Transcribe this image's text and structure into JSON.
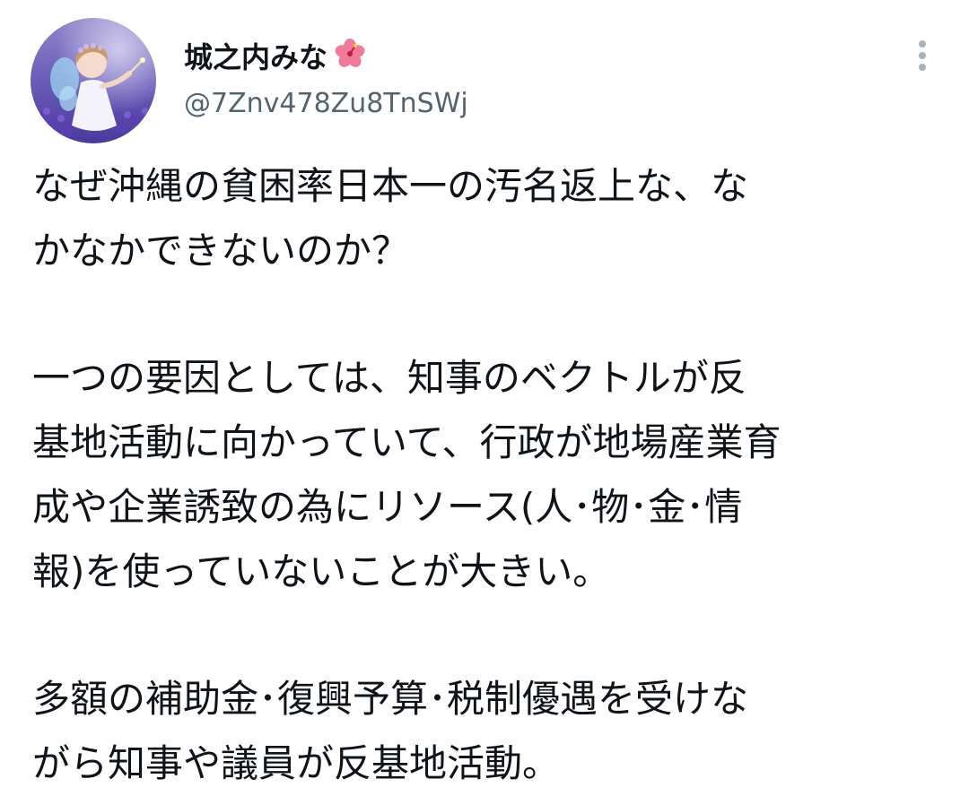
{
  "author": {
    "display_name": "城之内みな",
    "name_emoji": "hibiscus-icon",
    "handle": "@7Znv478Zu8TnSWj",
    "avatar": "child-fairy-in-lavender-field"
  },
  "menu": {
    "icon": "more-vertical-icon"
  },
  "tweet": {
    "paragraphs": [
      [
        "なぜ沖縄の貧困率日本一の汚名返上な、な",
        "かなかできないのか？"
      ],
      [
        "一つの要因としては、知事のベクトルが反",
        "基地活動に向かっていて、行政が地場産業育",
        "成や企業誘致の為にリソース(人･物･金･情",
        "報)を使っていないことが大きい。"
      ],
      [
        "多額の補助金･復興予算･税制優遇を受けな",
        "がら知事や議員が反基地活動。"
      ]
    ]
  },
  "colors": {
    "text": "#0f1419",
    "secondary": "#536471",
    "background": "#ffffff"
  }
}
